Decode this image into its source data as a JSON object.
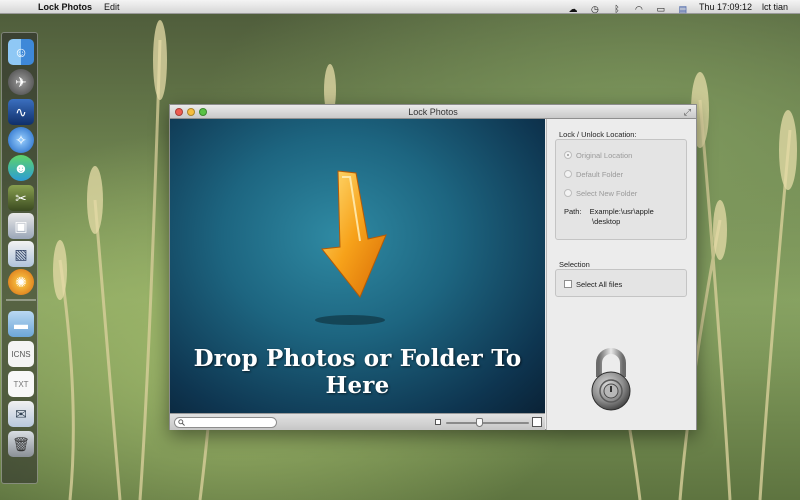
{
  "menubar": {
    "app_name": "Lock Photos",
    "menus": [
      "Edit"
    ],
    "clock": "Thu 17:09:12",
    "user": "lct tian",
    "status_icons": [
      "cloud-icon",
      "time-machine-icon",
      "bluetooth-icon",
      "wifi-icon",
      "battery-icon",
      "flag-icon"
    ]
  },
  "window": {
    "title": "Lock Photos",
    "drop_text": "Drop Photos or Folder To Here",
    "search_placeholder": ""
  },
  "sidebar": {
    "location_label": "Lock / Unlock  Location:",
    "options": [
      {
        "label": "Original Location",
        "selected": true
      },
      {
        "label": "Default Folder",
        "selected": false
      },
      {
        "label": "Select New Folder",
        "selected": false
      }
    ],
    "path_label": "Path:",
    "path_value_line1": "Example:\\usr\\apple",
    "path_value_line2": "\\desktop",
    "selection_label": "Selection",
    "select_all_label": "Select All files"
  },
  "dock_items": [
    "finder-icon",
    "launchpad-icon",
    "activity-monitor-icon",
    "safari-icon",
    "messenger-icon",
    "pliers-icon",
    "photo-lock-icon",
    "preview-icon",
    "ball-icon",
    "folder-icon",
    "document-icon",
    "text-file-icon",
    "mail-icon",
    "trash-icon"
  ],
  "colors": {
    "accent_close": "#ee5b50",
    "accent_min": "#f5bd3e",
    "accent_max": "#59c246",
    "arrow": "#f7a21a"
  }
}
